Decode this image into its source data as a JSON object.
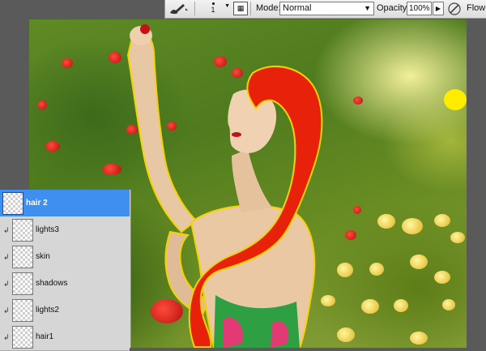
{
  "toolbar": {
    "brush_tool_icon": "brush-icon",
    "brush_size": "1",
    "toggle_brush_panel_icon": "brush-panel-icon",
    "mode_label": "Mode:",
    "mode_value": "Normal",
    "opacity_label": "Opacity:",
    "opacity_value": "100%",
    "airbrush_icon": "pressure-opacity-icon",
    "flow_label": "Flow:"
  },
  "layers": {
    "items": [
      {
        "name": "hair 2",
        "selected": true
      },
      {
        "name": "lights3",
        "selected": false
      },
      {
        "name": "skin",
        "selected": false
      },
      {
        "name": "shadows",
        "selected": false
      },
      {
        "name": "lights2",
        "selected": false
      },
      {
        "name": "hair1",
        "selected": false
      }
    ]
  },
  "colors": {
    "selection": "#3f8ff0",
    "brush_mark": "#ffec00",
    "hair": "#e8210a"
  }
}
